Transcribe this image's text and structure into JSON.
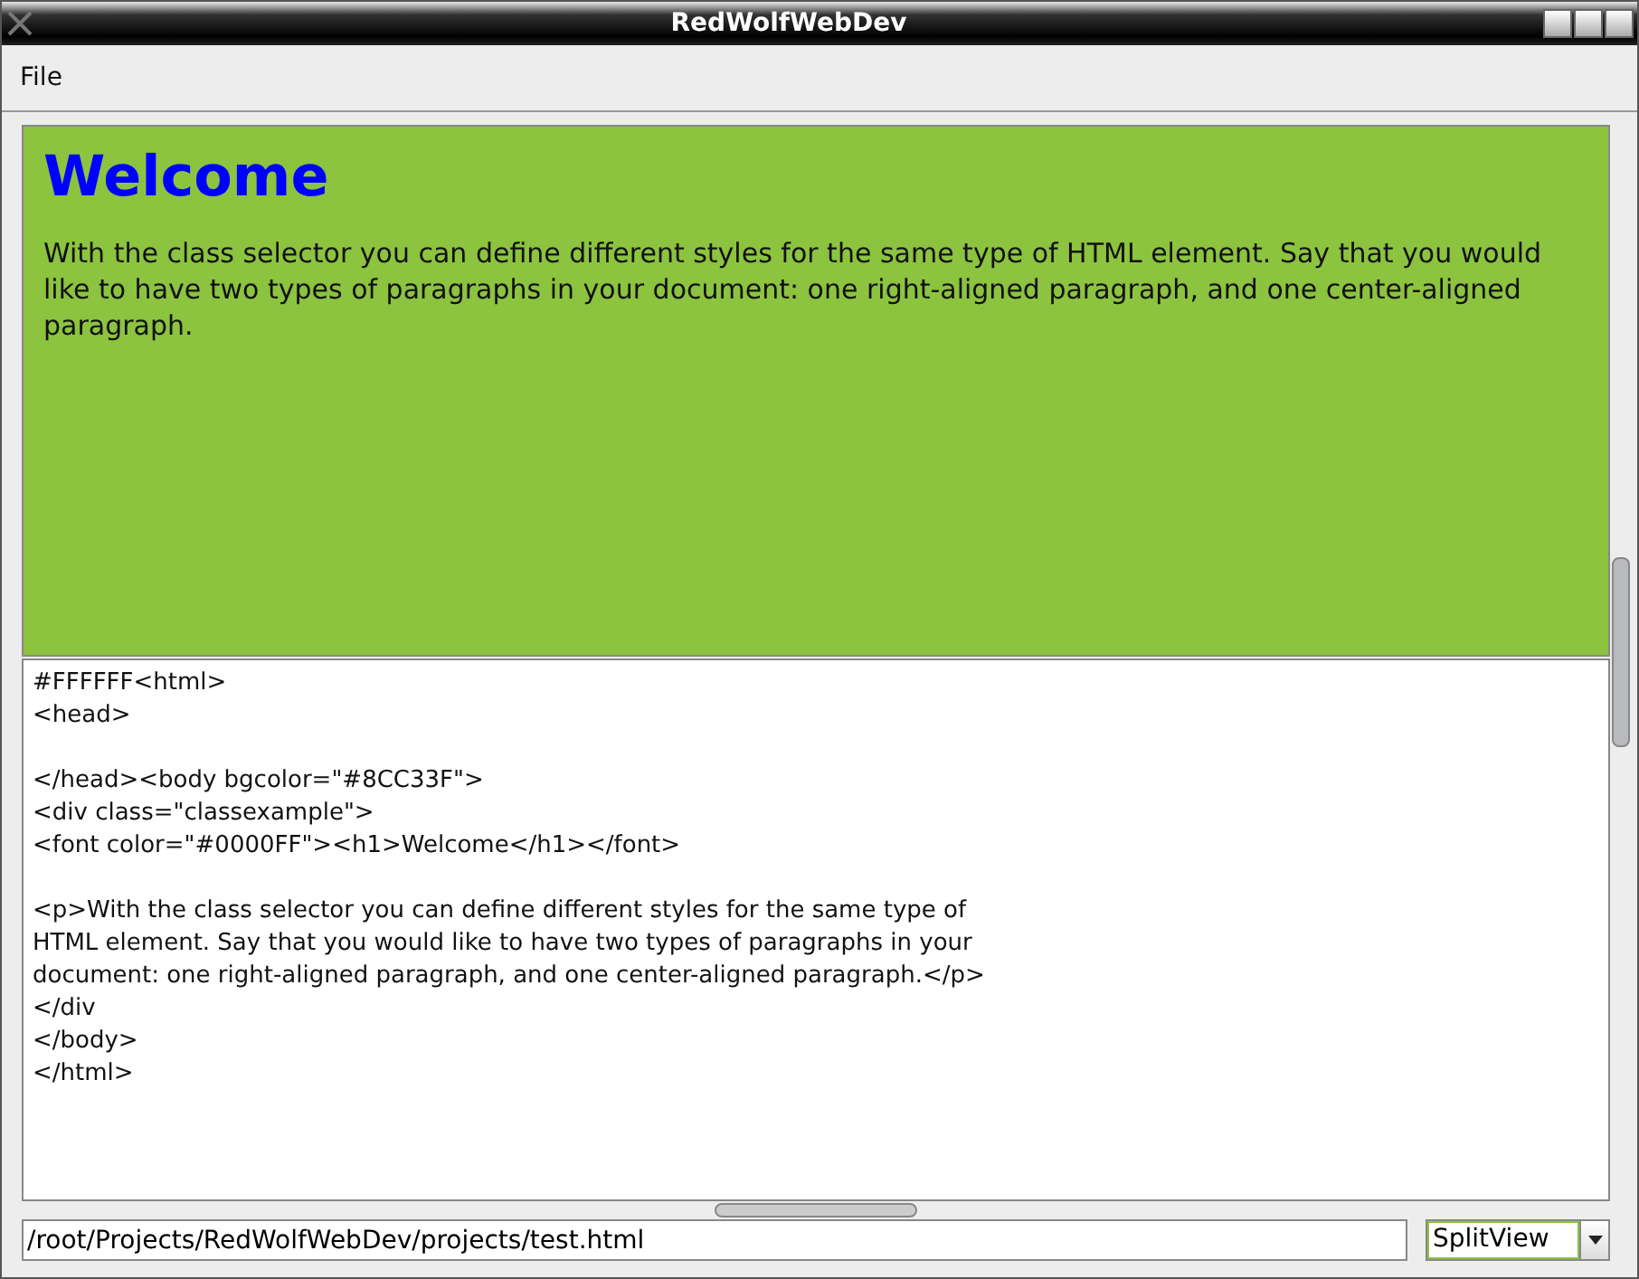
{
  "window": {
    "title": "RedWolfWebDev"
  },
  "menu": [
    "File"
  ],
  "preview": {
    "heading": "Welcome",
    "paragraph": "With the class selector you can define different styles for the same type of HTML element. Say that you would like to have two types of paragraphs in your document: one right-aligned paragraph, and one center-aligned paragraph."
  },
  "editor": {
    "blocks": [
      [
        "#FFFFFF<html>",
        "<head>"
      ],
      [
        "</head><body bgcolor=\"#8CC33F\">",
        "<div class=\"classexample\">",
        "<font color=\"#0000FF\"><h1>Welcome</h1></font>"
      ],
      [
        "<p>With the class selector you can define different styles for the same type of",
        "HTML element. Say that you would like to have two types of paragraphs in your",
        "document: one right-aligned paragraph, and one center-aligned paragraph.</p>",
        "</div",
        "</body>",
        "</html>"
      ]
    ]
  },
  "path_field": {
    "value": "/root/Projects/RedWolfWebDev/projects/test.html"
  },
  "view_select": {
    "value": "SplitView"
  }
}
